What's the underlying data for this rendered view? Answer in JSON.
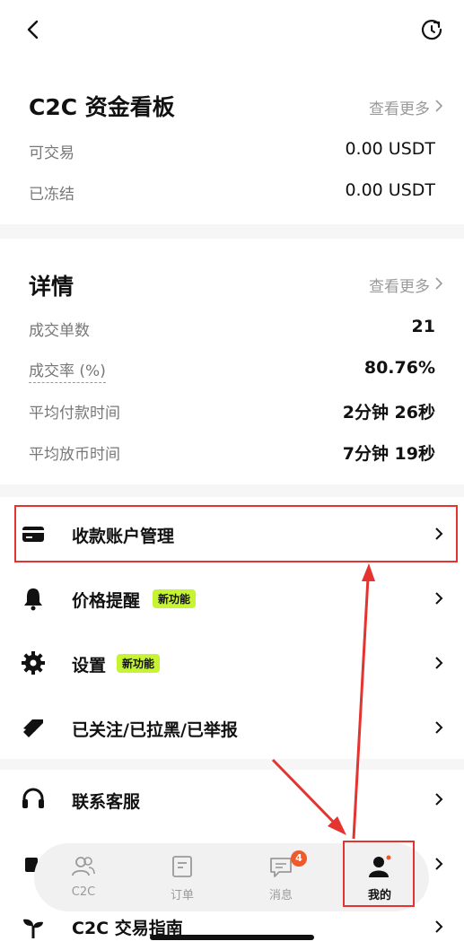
{
  "funds": {
    "title": "C2C 资金看板",
    "more": "查看更多",
    "rows": [
      {
        "label": "可交易",
        "value": "0.00 USDT"
      },
      {
        "label": "已冻结",
        "value": "0.00 USDT"
      }
    ]
  },
  "details": {
    "title": "详情",
    "more": "查看更多",
    "rows": [
      {
        "label": "成交单数",
        "value": "21"
      },
      {
        "label": "成交率 (%)",
        "value": "80.76%"
      },
      {
        "label": "平均付款时间",
        "value": "2分钟 26秒"
      },
      {
        "label": "平均放币时间",
        "value": "7分钟 19秒"
      }
    ]
  },
  "menu": [
    {
      "label": "收款账户管理",
      "icon": "card-icon"
    },
    {
      "label": "价格提醒",
      "icon": "bell-icon",
      "badge": "新功能"
    },
    {
      "label": "设置",
      "icon": "gear-icon",
      "badge": "新功能"
    },
    {
      "label": "已关注/已拉黑/已举报",
      "icon": "tag-icon"
    },
    {
      "label": "联系客服",
      "icon": "headset-icon"
    },
    {
      "label": "C2C 交易指南",
      "icon": "sprout-icon"
    }
  ],
  "bottom_nav": [
    {
      "label": "C2C",
      "icon": "users-icon"
    },
    {
      "label": "订单",
      "icon": "order-icon"
    },
    {
      "label": "消息",
      "icon": "message-icon",
      "count": "4"
    },
    {
      "label": "我的",
      "icon": "profile-icon",
      "active": true
    }
  ],
  "colors": {
    "highlight": "#e3342f",
    "badge_new": "#c6f432",
    "notification": "#f05a2a"
  }
}
